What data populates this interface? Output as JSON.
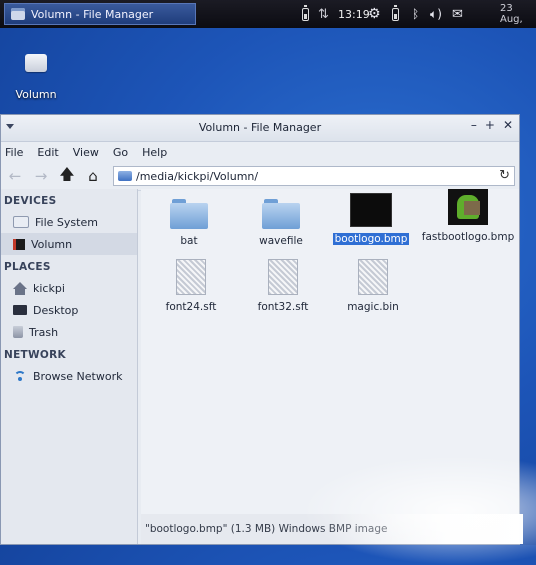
{
  "panel": {
    "task_title": "Volumn - File Manager",
    "clock": "13:19",
    "date": "23 Aug,"
  },
  "desktop": {
    "icon_label": "Volumn"
  },
  "window": {
    "title": "Volumn - File Manager",
    "menu": [
      "File",
      "Edit",
      "View",
      "Go",
      "Help"
    ],
    "address": "/media/kickpi/Volumn/"
  },
  "sidebar": {
    "devices_header": "DEVICES",
    "devices": [
      "File System",
      "Volumn"
    ],
    "places_header": "PLACES",
    "places": [
      "kickpi",
      "Desktop",
      "Trash"
    ],
    "network_header": "NETWORK",
    "network": [
      "Browse Network"
    ]
  },
  "files": [
    {
      "name": "bat",
      "kind": "folder"
    },
    {
      "name": "wavefile",
      "kind": "folder"
    },
    {
      "name": "bootlogo.bmp",
      "kind": "image-dark",
      "selected": true
    },
    {
      "name": "fastbootlogo.bmp",
      "kind": "image-android"
    },
    {
      "name": "font24.sft",
      "kind": "file"
    },
    {
      "name": "font32.sft",
      "kind": "file"
    },
    {
      "name": "magic.bin",
      "kind": "file"
    }
  ],
  "status": "\"bootlogo.bmp\" (1.3 MB) Windows BMP image",
  "colors": {
    "desktop_blue": "#1d55b8",
    "selection": "#2f6fd4"
  }
}
